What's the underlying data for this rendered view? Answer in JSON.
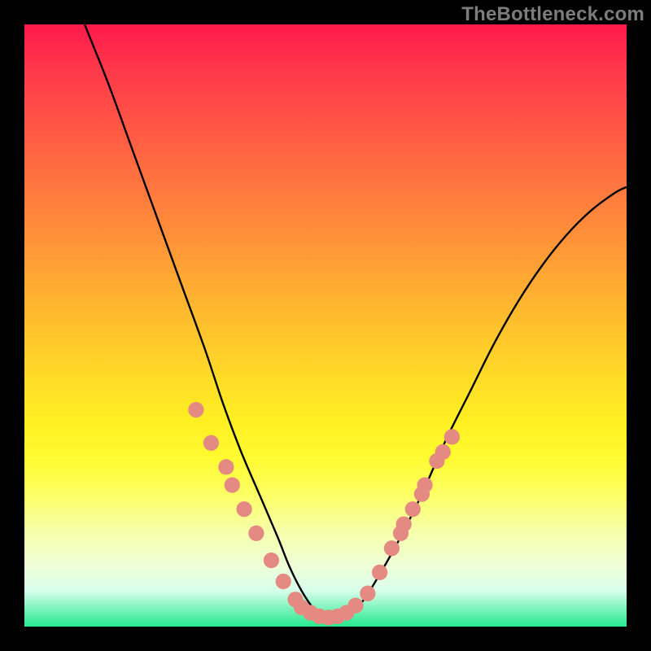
{
  "watermark": "TheBottleneck.com",
  "chart_data": {
    "type": "line",
    "title": "",
    "xlabel": "",
    "ylabel": "",
    "xlim": [
      0,
      100
    ],
    "ylim": [
      0,
      100
    ],
    "grid": false,
    "legend": false,
    "series": [
      {
        "name": "curve",
        "color": "#000000",
        "x": [
          10,
          14,
          18,
          22,
          26,
          30,
          33,
          36,
          39,
          42,
          44,
          46,
          48,
          50,
          52,
          54,
          56,
          58,
          62,
          66,
          70,
          74,
          78,
          82,
          86,
          90,
          94,
          98,
          100
        ],
        "y": [
          100,
          90,
          79,
          68,
          57,
          46,
          37,
          29,
          22,
          15,
          10,
          6,
          3,
          1,
          1,
          2,
          4,
          7,
          14,
          22,
          31,
          39,
          47,
          54,
          60,
          65,
          69,
          72,
          73
        ]
      }
    ],
    "markers": {
      "name": "dots",
      "color": "#e58a82",
      "radius_pct": 1.3,
      "points": [
        {
          "x": 28.5,
          "y": 36.0
        },
        {
          "x": 31.0,
          "y": 30.5
        },
        {
          "x": 33.5,
          "y": 26.5
        },
        {
          "x": 34.5,
          "y": 23.5
        },
        {
          "x": 36.5,
          "y": 19.5
        },
        {
          "x": 38.5,
          "y": 15.5
        },
        {
          "x": 41.0,
          "y": 11.0
        },
        {
          "x": 43.0,
          "y": 7.5
        },
        {
          "x": 45.0,
          "y": 4.5
        },
        {
          "x": 46.0,
          "y": 3.2
        },
        {
          "x": 47.5,
          "y": 2.3
        },
        {
          "x": 49.0,
          "y": 1.7
        },
        {
          "x": 50.5,
          "y": 1.5
        },
        {
          "x": 52.0,
          "y": 1.7
        },
        {
          "x": 53.5,
          "y": 2.3
        },
        {
          "x": 55.0,
          "y": 3.5
        },
        {
          "x": 57.0,
          "y": 5.5
        },
        {
          "x": 59.0,
          "y": 9.0
        },
        {
          "x": 61.0,
          "y": 13.0
        },
        {
          "x": 62.5,
          "y": 15.5
        },
        {
          "x": 63.0,
          "y": 17.0
        },
        {
          "x": 64.5,
          "y": 19.5
        },
        {
          "x": 66.0,
          "y": 22.0
        },
        {
          "x": 66.5,
          "y": 23.5
        },
        {
          "x": 68.5,
          "y": 27.5
        },
        {
          "x": 69.5,
          "y": 29.0
        },
        {
          "x": 71.0,
          "y": 31.5
        }
      ]
    },
    "background_gradient": {
      "direction": "top-to-bottom",
      "stops": [
        {
          "pos": 0.0,
          "color": "#ff1a4b"
        },
        {
          "pos": 0.35,
          "color": "#ff8a38"
        },
        {
          "pos": 0.65,
          "color": "#fff024"
        },
        {
          "pos": 0.9,
          "color": "#eeffd8"
        },
        {
          "pos": 1.0,
          "color": "#25e98e"
        }
      ]
    }
  }
}
